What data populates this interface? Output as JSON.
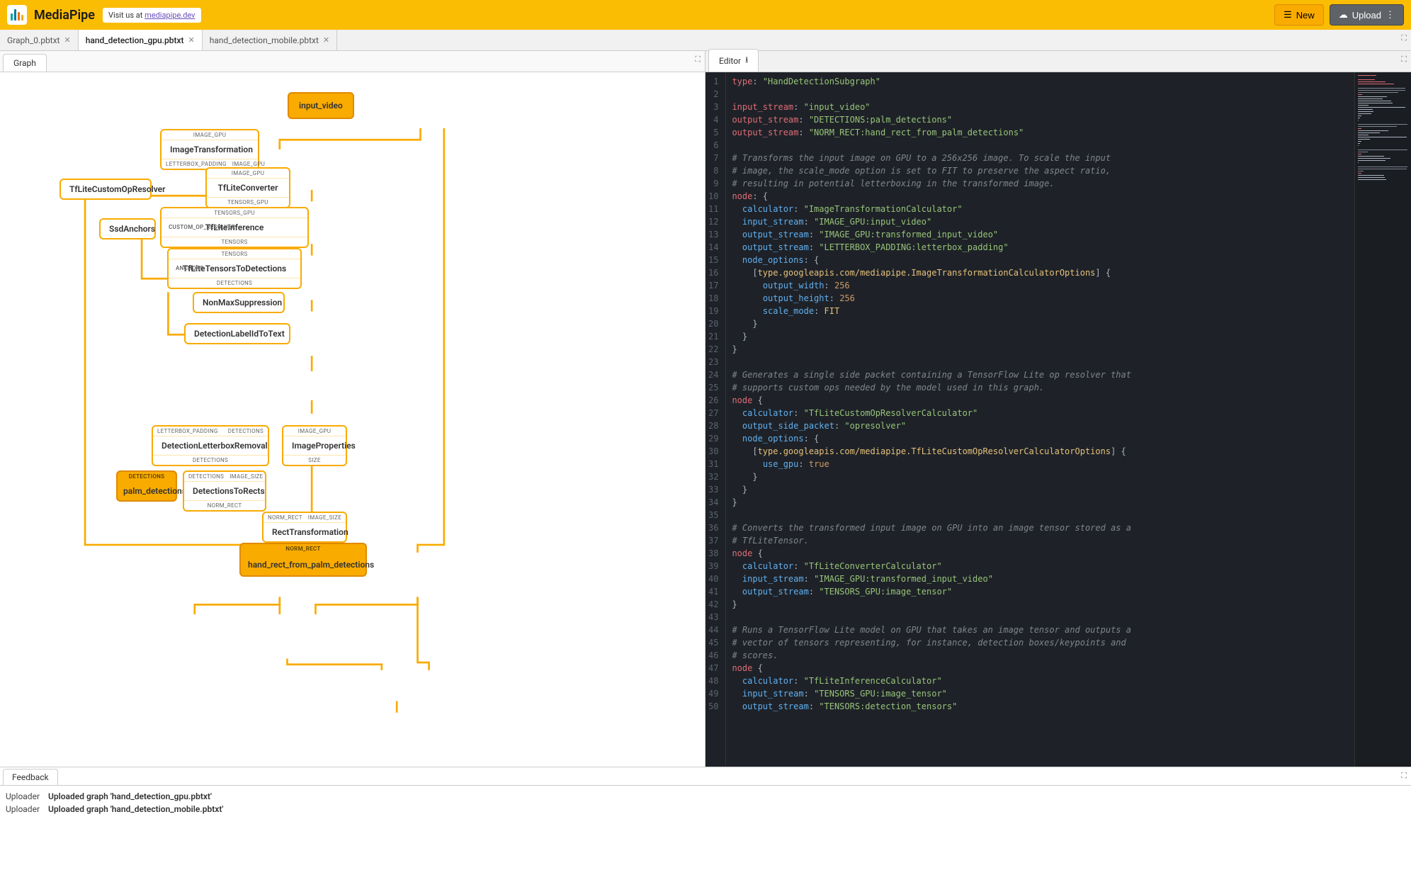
{
  "brand": "MediaPipe",
  "visit": {
    "prefix": "Visit us at ",
    "link_text": "mediapipe.dev"
  },
  "header_buttons": {
    "new": "New",
    "upload": "Upload"
  },
  "file_tabs": [
    {
      "name": "Graph_0.pbtxt",
      "active": false
    },
    {
      "name": "hand_detection_gpu.pbtxt",
      "active": true
    },
    {
      "name": "hand_detection_mobile.pbtxt",
      "active": false
    }
  ],
  "graph_tab": "Graph",
  "editor_tab": "Editor",
  "graph": {
    "input_video": "input_video",
    "imageTransformation": {
      "top": "IMAGE_GPU",
      "title": "ImageTransformation",
      "bottom_left": "LETTERBOX_PADDING",
      "bottom_right": "IMAGE_GPU"
    },
    "tfLiteCustomOpResolver": {
      "title": "TfLiteCustomOpResolver"
    },
    "tfLiteConverter": {
      "top": "IMAGE_GPU",
      "title": "TfLiteConverter",
      "bottom": "TENSORS_GPU"
    },
    "ssdAnchors": {
      "title": "SsdAnchors"
    },
    "tfLiteInference": {
      "top": "TENSORS_GPU",
      "left": "CUSTOM_OP_RESOLVER",
      "title": "TfLiteInference",
      "bottom": "TENSORS"
    },
    "tfLiteTensorsToDetections": {
      "top": "TENSORS",
      "left": "ANCHORS",
      "title": "TfLiteTensorsToDetections",
      "bottom": "DETECTIONS"
    },
    "nonMaxSuppression": {
      "title": "NonMaxSuppression"
    },
    "detectionLabelIdToText": {
      "title": "DetectionLabelIdToText"
    },
    "detectionLetterboxRemoval": {
      "top_left": "LETTERBOX_PADDING",
      "top_right": "DETECTIONS",
      "title": "DetectionLetterboxRemoval",
      "bottom": "DETECTIONS"
    },
    "imageProperties": {
      "top": "IMAGE_GPU",
      "title": "ImageProperties",
      "bottom": "SIZE"
    },
    "palm_detections": {
      "top": "DETECTIONS",
      "title": "palm_detections"
    },
    "detectionsToRects": {
      "top_left": "DETECTIONS",
      "top_right": "IMAGE_SIZE",
      "title": "DetectionsToRects",
      "bottom": "NORM_RECT"
    },
    "rectTransformation": {
      "top_left": "NORM_RECT",
      "top_right": "IMAGE_SIZE",
      "title": "RectTransformation"
    },
    "hand_rect": {
      "top": "NORM_RECT",
      "title": "hand_rect_from_palm_detections"
    }
  },
  "code_lines": [
    [
      [
        "key",
        "type"
      ],
      [
        "pun",
        ": "
      ],
      [
        "str",
        "\"HandDetectionSubgraph\""
      ]
    ],
    [],
    [
      [
        "key",
        "input_stream"
      ],
      [
        "pun",
        ": "
      ],
      [
        "str",
        "\"input_video\""
      ]
    ],
    [
      [
        "key",
        "output_stream"
      ],
      [
        "pun",
        ": "
      ],
      [
        "str",
        "\"DETECTIONS:palm_detections\""
      ]
    ],
    [
      [
        "key",
        "output_stream"
      ],
      [
        "pun",
        ": "
      ],
      [
        "str",
        "\"NORM_RECT:hand_rect_from_palm_detections\""
      ]
    ],
    [],
    [
      [
        "com",
        "# Transforms the input image on GPU to a 256x256 image. To scale the input"
      ]
    ],
    [
      [
        "com",
        "# image, the scale_mode option is set to FIT to preserve the aspect ratio,"
      ]
    ],
    [
      [
        "com",
        "# resulting in potential letterboxing in the transformed image."
      ]
    ],
    [
      [
        "key",
        "node"
      ],
      [
        "pun",
        ": {"
      ]
    ],
    [
      [
        "pun",
        "  "
      ],
      [
        "prop",
        "calculator"
      ],
      [
        "pun",
        ": "
      ],
      [
        "str",
        "\"ImageTransformationCalculator\""
      ]
    ],
    [
      [
        "pun",
        "  "
      ],
      [
        "prop",
        "input_stream"
      ],
      [
        "pun",
        ": "
      ],
      [
        "str",
        "\"IMAGE_GPU:input_video\""
      ]
    ],
    [
      [
        "pun",
        "  "
      ],
      [
        "prop",
        "output_stream"
      ],
      [
        "pun",
        ": "
      ],
      [
        "str",
        "\"IMAGE_GPU:transformed_input_video\""
      ]
    ],
    [
      [
        "pun",
        "  "
      ],
      [
        "prop",
        "output_stream"
      ],
      [
        "pun",
        ": "
      ],
      [
        "str",
        "\"LETTERBOX_PADDING:letterbox_padding\""
      ]
    ],
    [
      [
        "pun",
        "  "
      ],
      [
        "prop",
        "node_options"
      ],
      [
        "pun",
        ": {"
      ]
    ],
    [
      [
        "pun",
        "    ["
      ],
      [
        "type",
        "type.googleapis.com/mediapipe.ImageTransformationCalculatorOptions"
      ],
      [
        "pun",
        "] {"
      ]
    ],
    [
      [
        "pun",
        "      "
      ],
      [
        "prop",
        "output_width"
      ],
      [
        "pun",
        ": "
      ],
      [
        "num",
        "256"
      ]
    ],
    [
      [
        "pun",
        "      "
      ],
      [
        "prop",
        "output_height"
      ],
      [
        "pun",
        ": "
      ],
      [
        "num",
        "256"
      ]
    ],
    [
      [
        "pun",
        "      "
      ],
      [
        "prop",
        "scale_mode"
      ],
      [
        "pun",
        ": "
      ],
      [
        "type",
        "FIT"
      ]
    ],
    [
      [
        "pun",
        "    }"
      ]
    ],
    [
      [
        "pun",
        "  }"
      ]
    ],
    [
      [
        "pun",
        "}"
      ]
    ],
    [],
    [
      [
        "com",
        "# Generates a single side packet containing a TensorFlow Lite op resolver that"
      ]
    ],
    [
      [
        "com",
        "# supports custom ops needed by the model used in this graph."
      ]
    ],
    [
      [
        "key",
        "node"
      ],
      [
        "pun",
        " {"
      ]
    ],
    [
      [
        "pun",
        "  "
      ],
      [
        "prop",
        "calculator"
      ],
      [
        "pun",
        ": "
      ],
      [
        "str",
        "\"TfLiteCustomOpResolverCalculator\""
      ]
    ],
    [
      [
        "pun",
        "  "
      ],
      [
        "prop",
        "output_side_packet"
      ],
      [
        "pun",
        ": "
      ],
      [
        "str",
        "\"opresolver\""
      ]
    ],
    [
      [
        "pun",
        "  "
      ],
      [
        "prop",
        "node_options"
      ],
      [
        "pun",
        ": {"
      ]
    ],
    [
      [
        "pun",
        "    ["
      ],
      [
        "type",
        "type.googleapis.com/mediapipe.TfLiteCustomOpResolverCalculatorOptions"
      ],
      [
        "pun",
        "] {"
      ]
    ],
    [
      [
        "pun",
        "      "
      ],
      [
        "prop",
        "use_gpu"
      ],
      [
        "pun",
        ": "
      ],
      [
        "bool",
        "true"
      ]
    ],
    [
      [
        "pun",
        "    }"
      ]
    ],
    [
      [
        "pun",
        "  }"
      ]
    ],
    [
      [
        "pun",
        "}"
      ]
    ],
    [],
    [
      [
        "com",
        "# Converts the transformed input image on GPU into an image tensor stored as a"
      ]
    ],
    [
      [
        "com",
        "# TfLiteTensor."
      ]
    ],
    [
      [
        "key",
        "node"
      ],
      [
        "pun",
        " {"
      ]
    ],
    [
      [
        "pun",
        "  "
      ],
      [
        "prop",
        "calculator"
      ],
      [
        "pun",
        ": "
      ],
      [
        "str",
        "\"TfLiteConverterCalculator\""
      ]
    ],
    [
      [
        "pun",
        "  "
      ],
      [
        "prop",
        "input_stream"
      ],
      [
        "pun",
        ": "
      ],
      [
        "str",
        "\"IMAGE_GPU:transformed_input_video\""
      ]
    ],
    [
      [
        "pun",
        "  "
      ],
      [
        "prop",
        "output_stream"
      ],
      [
        "pun",
        ": "
      ],
      [
        "str",
        "\"TENSORS_GPU:image_tensor\""
      ]
    ],
    [
      [
        "pun",
        "}"
      ]
    ],
    [],
    [
      [
        "com",
        "# Runs a TensorFlow Lite model on GPU that takes an image tensor and outputs a"
      ]
    ],
    [
      [
        "com",
        "# vector of tensors representing, for instance, detection boxes/keypoints and"
      ]
    ],
    [
      [
        "com",
        "# scores."
      ]
    ],
    [
      [
        "key",
        "node"
      ],
      [
        "pun",
        " {"
      ]
    ],
    [
      [
        "pun",
        "  "
      ],
      [
        "prop",
        "calculator"
      ],
      [
        "pun",
        ": "
      ],
      [
        "str",
        "\"TfLiteInferenceCalculator\""
      ]
    ],
    [
      [
        "pun",
        "  "
      ],
      [
        "prop",
        "input_stream"
      ],
      [
        "pun",
        ": "
      ],
      [
        "str",
        "\"TENSORS_GPU:image_tensor\""
      ]
    ],
    [
      [
        "pun",
        "  "
      ],
      [
        "prop",
        "output_stream"
      ],
      [
        "pun",
        ": "
      ],
      [
        "str",
        "\"TENSORS:detection_tensors\""
      ]
    ]
  ],
  "feedback_tab": "Feedback",
  "feedback": [
    {
      "src": "Uploader",
      "msg": "Uploaded graph 'hand_detection_gpu.pbtxt'"
    },
    {
      "src": "Uploader",
      "msg": "Uploaded graph 'hand_detection_mobile.pbtxt'"
    }
  ]
}
